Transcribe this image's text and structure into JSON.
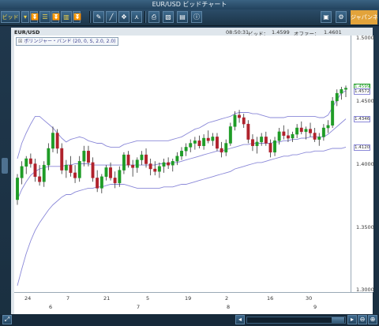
{
  "window": {
    "title": "EUR/USD ビッドチャート"
  },
  "toolbar": {
    "bid_label": "ビッド",
    "logo_text": "ジャパンネット"
  },
  "chart": {
    "symbol": "EUR/USD",
    "time": "08:50:31",
    "bid_label": "ビッド：",
    "bid_value": "1.4599",
    "offer_label": "オファー：",
    "offer_value": "1.4601",
    "indicator": "ボリンジャー・バンド (20, 0, S, 2.0, 2.0)",
    "price_labels": [
      "1.5000",
      "1.4500",
      "1.4000",
      "1.3500",
      "1.3000"
    ],
    "markers": {
      "current": "1.4599",
      "upper": "1.4572",
      "mid": "1.4346",
      "lower": "1.4120"
    },
    "day_labels": [
      "24",
      "7",
      "21",
      "5",
      "19",
      "2",
      "16",
      "30"
    ],
    "month_labels": [
      "6",
      "7",
      "8",
      "9"
    ]
  },
  "chart_data": {
    "type": "candlestick",
    "y_range": [
      1.3,
      1.5
    ],
    "up_color": "#1f9c27",
    "down_color": "#b0222c",
    "band_color": "#8a88d8",
    "candles": [
      [
        1.372,
        1.392,
        1.368,
        1.389
      ],
      [
        1.389,
        1.402,
        1.384,
        1.398
      ],
      [
        1.398,
        1.406,
        1.392,
        1.404
      ],
      [
        1.404,
        1.408,
        1.397,
        1.4
      ],
      [
        1.4,
        1.404,
        1.386,
        1.39
      ],
      [
        1.39,
        1.399,
        1.383,
        1.386
      ],
      [
        1.386,
        1.402,
        1.382,
        1.399
      ],
      [
        1.399,
        1.416,
        1.395,
        1.412
      ],
      [
        1.412,
        1.429,
        1.409,
        1.424
      ],
      [
        1.424,
        1.427,
        1.408,
        1.412
      ],
      [
        1.412,
        1.416,
        1.392,
        1.395
      ],
      [
        1.395,
        1.403,
        1.389,
        1.399
      ],
      [
        1.399,
        1.406,
        1.39,
        1.393
      ],
      [
        1.393,
        1.399,
        1.385,
        1.389
      ],
      [
        1.389,
        1.406,
        1.386,
        1.402
      ],
      [
        1.402,
        1.414,
        1.398,
        1.41
      ],
      [
        1.41,
        1.414,
        1.398,
        1.401
      ],
      [
        1.401,
        1.405,
        1.386,
        1.389
      ],
      [
        1.389,
        1.395,
        1.378,
        1.381
      ],
      [
        1.381,
        1.392,
        1.377,
        1.39
      ],
      [
        1.39,
        1.399,
        1.387,
        1.397
      ],
      [
        1.397,
        1.401,
        1.387,
        1.389
      ],
      [
        1.389,
        1.394,
        1.381,
        1.385
      ],
      [
        1.385,
        1.398,
        1.382,
        1.395
      ],
      [
        1.395,
        1.409,
        1.392,
        1.407
      ],
      [
        1.407,
        1.41,
        1.397,
        1.399
      ],
      [
        1.399,
        1.403,
        1.39,
        1.397
      ],
      [
        1.397,
        1.405,
        1.393,
        1.403
      ],
      [
        1.403,
        1.41,
        1.399,
        1.407
      ],
      [
        1.407,
        1.412,
        1.397,
        1.4
      ],
      [
        1.4,
        1.404,
        1.391,
        1.396
      ],
      [
        1.396,
        1.402,
        1.391,
        1.394
      ],
      [
        1.394,
        1.401,
        1.389,
        1.398
      ],
      [
        1.398,
        1.404,
        1.393,
        1.401
      ],
      [
        1.401,
        1.405,
        1.396,
        1.399
      ],
      [
        1.399,
        1.404,
        1.394,
        1.402
      ],
      [
        1.402,
        1.409,
        1.399,
        1.406
      ],
      [
        1.406,
        1.413,
        1.403,
        1.41
      ],
      [
        1.41,
        1.416,
        1.406,
        1.413
      ],
      [
        1.413,
        1.419,
        1.409,
        1.416
      ],
      [
        1.416,
        1.421,
        1.411,
        1.418
      ],
      [
        1.418,
        1.422,
        1.412,
        1.414
      ],
      [
        1.414,
        1.423,
        1.411,
        1.42
      ],
      [
        1.42,
        1.426,
        1.416,
        1.418
      ],
      [
        1.418,
        1.424,
        1.414,
        1.421
      ],
      [
        1.421,
        1.424,
        1.41,
        1.412
      ],
      [
        1.412,
        1.417,
        1.405,
        1.409
      ],
      [
        1.409,
        1.419,
        1.406,
        1.416
      ],
      [
        1.416,
        1.432,
        1.414,
        1.429
      ],
      [
        1.429,
        1.441,
        1.426,
        1.438
      ],
      [
        1.438,
        1.442,
        1.432,
        1.436
      ],
      [
        1.436,
        1.439,
        1.428,
        1.431
      ],
      [
        1.431,
        1.434,
        1.416,
        1.419
      ],
      [
        1.419,
        1.423,
        1.41,
        1.414
      ],
      [
        1.414,
        1.421,
        1.408,
        1.417
      ],
      [
        1.417,
        1.424,
        1.414,
        1.421
      ],
      [
        1.421,
        1.425,
        1.414,
        1.416
      ],
      [
        1.416,
        1.419,
        1.405,
        1.409
      ],
      [
        1.409,
        1.421,
        1.406,
        1.418
      ],
      [
        1.418,
        1.428,
        1.415,
        1.425
      ],
      [
        1.425,
        1.43,
        1.419,
        1.422
      ],
      [
        1.422,
        1.427,
        1.417,
        1.42
      ],
      [
        1.42,
        1.425,
        1.417,
        1.423
      ],
      [
        1.423,
        1.431,
        1.42,
        1.428
      ],
      [
        1.428,
        1.433,
        1.423,
        1.425
      ],
      [
        1.425,
        1.429,
        1.419,
        1.427
      ],
      [
        1.427,
        1.432,
        1.421,
        1.424
      ],
      [
        1.424,
        1.428,
        1.417,
        1.419
      ],
      [
        1.419,
        1.424,
        1.414,
        1.421
      ],
      [
        1.421,
        1.431,
        1.418,
        1.428
      ],
      [
        1.428,
        1.434,
        1.424,
        1.43
      ],
      [
        1.43,
        1.452,
        1.428,
        1.449
      ],
      [
        1.449,
        1.458,
        1.445,
        1.455
      ],
      [
        1.455,
        1.46,
        1.45,
        1.458
      ],
      [
        1.458,
        1.461,
        1.452,
        1.459
      ]
    ],
    "bands": {
      "upper": [
        1.404,
        1.416,
        1.424,
        1.431,
        1.437,
        1.437,
        1.434,
        1.431,
        1.428,
        1.424,
        1.42,
        1.417,
        1.419,
        1.42,
        1.421,
        1.42,
        1.418,
        1.417,
        1.416,
        1.416,
        1.414,
        1.413,
        1.413,
        1.413,
        1.415,
        1.416,
        1.417,
        1.418,
        1.418,
        1.418,
        1.418,
        1.418,
        1.418,
        1.418,
        1.418,
        1.419,
        1.42,
        1.421,
        1.423,
        1.425,
        1.427,
        1.428,
        1.43,
        1.432,
        1.433,
        1.434,
        1.435,
        1.436,
        1.437,
        1.439,
        1.44,
        1.44,
        1.44,
        1.439,
        1.439,
        1.438,
        1.437,
        1.436,
        1.436,
        1.436,
        1.436,
        1.437,
        1.437,
        1.437,
        1.437,
        1.437,
        1.437,
        1.437,
        1.436,
        1.436,
        1.438,
        1.444,
        1.45,
        1.455,
        1.457
      ],
      "mid": [
        1.372,
        1.38,
        1.386,
        1.391,
        1.394,
        1.396,
        1.397,
        1.398,
        1.398,
        1.398,
        1.398,
        1.399,
        1.399,
        1.4,
        1.4,
        1.4,
        1.4,
        1.399,
        1.399,
        1.399,
        1.399,
        1.399,
        1.399,
        1.399,
        1.399,
        1.399,
        1.399,
        1.399,
        1.399,
        1.399,
        1.399,
        1.399,
        1.4,
        1.4,
        1.4,
        1.401,
        1.401,
        1.402,
        1.403,
        1.404,
        1.405,
        1.406,
        1.407,
        1.408,
        1.409,
        1.41,
        1.41,
        1.411,
        1.412,
        1.413,
        1.414,
        1.415,
        1.415,
        1.416,
        1.416,
        1.416,
        1.416,
        1.416,
        1.417,
        1.417,
        1.418,
        1.418,
        1.419,
        1.419,
        1.42,
        1.42,
        1.421,
        1.421,
        1.421,
        1.421,
        1.423,
        1.426,
        1.429,
        1.432,
        1.435
      ],
      "lower": [
        1.305,
        1.318,
        1.33,
        1.34,
        1.348,
        1.354,
        1.359,
        1.364,
        1.368,
        1.371,
        1.374,
        1.376,
        1.376,
        1.378,
        1.379,
        1.38,
        1.381,
        1.381,
        1.382,
        1.382,
        1.383,
        1.384,
        1.384,
        1.384,
        1.384,
        1.383,
        1.382,
        1.381,
        1.381,
        1.381,
        1.381,
        1.381,
        1.381,
        1.382,
        1.382,
        1.382,
        1.383,
        1.384,
        1.384,
        1.385,
        1.386,
        1.387,
        1.388,
        1.389,
        1.39,
        1.391,
        1.392,
        1.393,
        1.394,
        1.396,
        1.397,
        1.398,
        1.399,
        1.4,
        1.401,
        1.401,
        1.402,
        1.403,
        1.404,
        1.405,
        1.406,
        1.406,
        1.407,
        1.407,
        1.408,
        1.409,
        1.409,
        1.41,
        1.41,
        1.41,
        1.411,
        1.412,
        1.412,
        1.412,
        1.413
      ]
    }
  }
}
